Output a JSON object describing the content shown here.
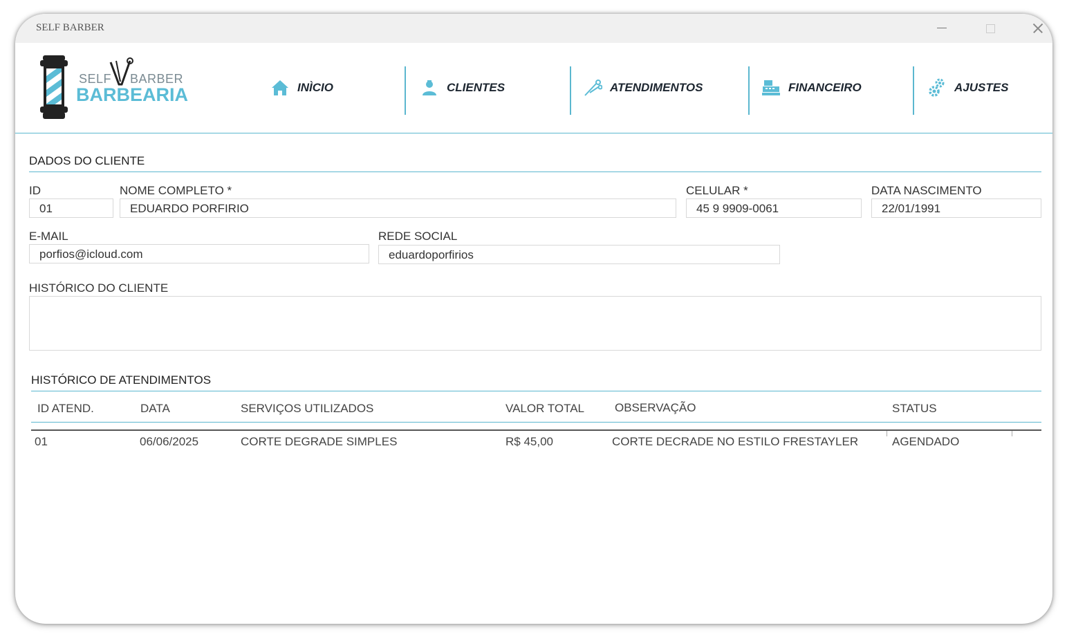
{
  "window": {
    "title": "SELF BARBER"
  },
  "logo": {
    "self": "SELF",
    "barber": "BARBER",
    "brand": "BARBEARIA"
  },
  "nav": [
    {
      "label": "INÌCIO",
      "icon": "home-icon"
    },
    {
      "label": "CLIENTES",
      "icon": "user-icon"
    },
    {
      "label": "ATENDIMENTOS",
      "icon": "scissors-icon"
    },
    {
      "label": "FINANCEIRO",
      "icon": "cash-register-icon"
    },
    {
      "label": "AJUSTES",
      "icon": "gears-icon"
    }
  ],
  "client": {
    "section_title": "DADOS DO CLIENTE",
    "id": {
      "label": "ID",
      "value": "01"
    },
    "name": {
      "label": "NOME COMPLETO *",
      "value": "EDUARDO PORFIRIO"
    },
    "phone": {
      "label": "CELULAR *",
      "value": "45 9 9909-0061"
    },
    "birth": {
      "label": "DATA NASCIMENTO",
      "value": "22/01/1991"
    },
    "email": {
      "label": "E-MAIL",
      "value": "porfios@icloud.com"
    },
    "social": {
      "label": "REDE SOCIAL",
      "value": "eduardoporfirios"
    },
    "history": {
      "label": "HISTÓRICO DO CLIENTE",
      "value": ""
    }
  },
  "appointments": {
    "section_title": "HISTÓRICO DE ATENDIMENTOS",
    "columns": [
      "ID ATEND.",
      "DATA",
      "SERVIÇOS UTILIZADOS",
      "VALOR TOTAL",
      "OBSERVAÇÃO",
      "STATUS"
    ],
    "rows": [
      [
        "01",
        "06/06/2025",
        "CORTE DEGRADE SIMPLES",
        "R$ 45,00",
        "CORTE DECRADE NO ESTILO FRESTAYLER",
        "AGENDADO"
      ]
    ]
  },
  "colors": {
    "accent": "#5bbcd6",
    "line": "#5bb7cf",
    "nav_text": "#1d2630"
  }
}
